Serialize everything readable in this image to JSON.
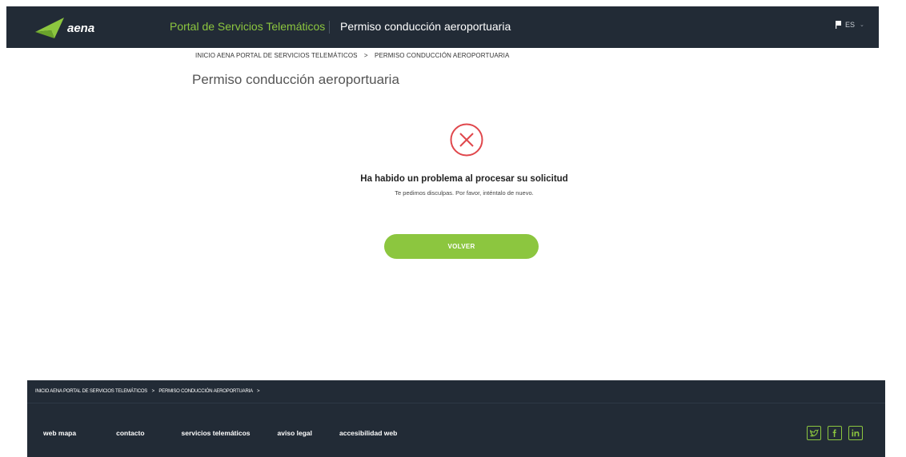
{
  "header": {
    "logo_text": "aena",
    "portal_title": "Portal de Servicios Telemáticos",
    "subtitle": "Permiso conducción aeroportuaria",
    "language": "ES"
  },
  "breadcrumb": {
    "home": "INICIO AENA PORTAL DE SERVICIOS TELEMÁTICOS",
    "separator": ">",
    "current": "PERMISO CONDUCCIÓN AEROPORTUARIA"
  },
  "page_title": "Permiso conducción aeroportuaria",
  "error": {
    "icon": "error-circle-x-icon",
    "title": "Ha habido un problema al procesar su solicitud",
    "message": "Te pedimos disculpas. Por favor, inténtalo de nuevo.",
    "button_label": "VOLVER"
  },
  "footer": {
    "breadcrumb_home": "INICIO AENA PORTAL DE SERVICIOS TELEMÁTICOS",
    "breadcrumb_current": "PERMISO CONDUCCIÓN AEROPORTUARIA",
    "separator": ">",
    "links": [
      "web mapa",
      "contacto",
      "servicios telemáticos",
      "aviso legal",
      "accesibilidad web"
    ],
    "social": [
      "twitter-icon",
      "facebook-icon",
      "linkedin-icon"
    ]
  },
  "colors": {
    "header_bg": "#222b36",
    "accent_green": "#8cc63f",
    "error_red": "#e0474c"
  }
}
